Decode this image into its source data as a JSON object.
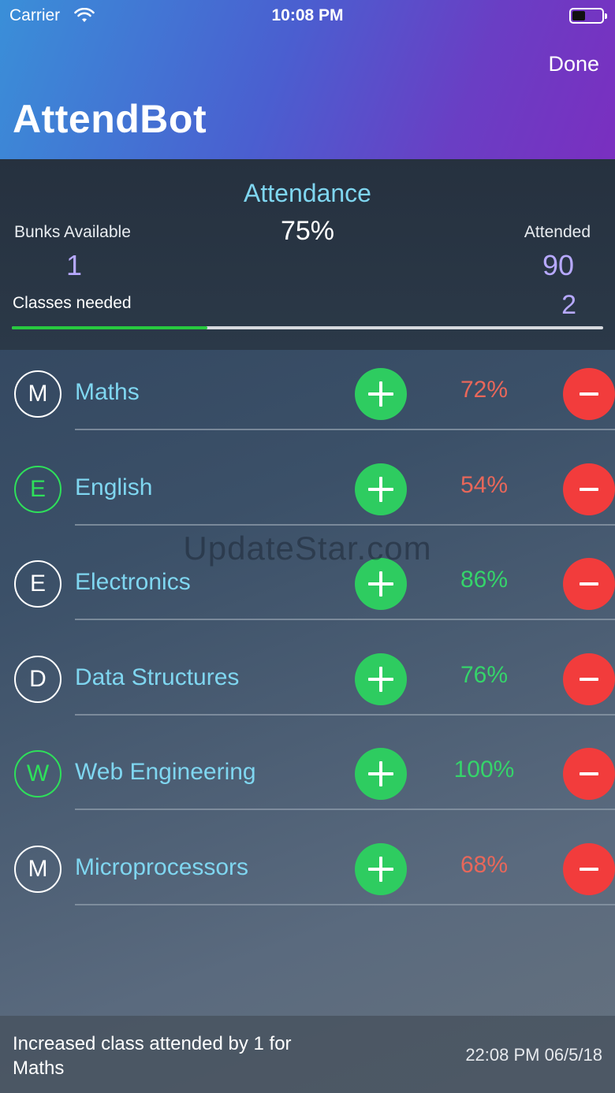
{
  "status_bar": {
    "carrier": "Carrier",
    "time": "10:08 PM"
  },
  "header": {
    "done_label": "Done",
    "title": "AttendBot"
  },
  "summary": {
    "attendance_label": "Attendance",
    "attendance_value": "75%",
    "bunks_label": "Bunks Available",
    "bunks_value": "1",
    "attended_label": "Attended",
    "attended_value": "90",
    "classes_needed_label": "Classes needed",
    "classes_needed_value": "2",
    "progress_fraction": 0.33
  },
  "subjects": [
    {
      "initial": "M",
      "name": "Maths",
      "percent": "72%",
      "status": "low"
    },
    {
      "initial": "E",
      "name": "English",
      "percent": "54%",
      "status": "low"
    },
    {
      "initial": "E",
      "name": "Electronics",
      "percent": "86%",
      "status": "ok"
    },
    {
      "initial": "D",
      "name": "Data Structures",
      "percent": "76%",
      "status": "ok"
    },
    {
      "initial": "W",
      "name": "Web Engineering",
      "percent": "100%",
      "status": "ok"
    },
    {
      "initial": "M",
      "name": "Microprocessors",
      "percent": "68%",
      "status": "low"
    }
  ],
  "avatar_highlight": [
    false,
    true,
    false,
    false,
    true,
    false
  ],
  "watermark": "UpdateStar.com",
  "footer": {
    "message": "Increased class attended by 1 for Maths",
    "timestamp": "22:08 PM 06/5/18"
  },
  "colors": {
    "low": "#e8675a",
    "ok": "#35d46a",
    "plus": "#2ecc60",
    "minus": "#f23c3c",
    "accent": "#7fd6f0",
    "stat_value": "#b7a9ff"
  },
  "icons": {
    "wifi": "wifi-icon",
    "battery": "battery-icon",
    "plus": "plus-icon",
    "minus": "minus-icon"
  }
}
